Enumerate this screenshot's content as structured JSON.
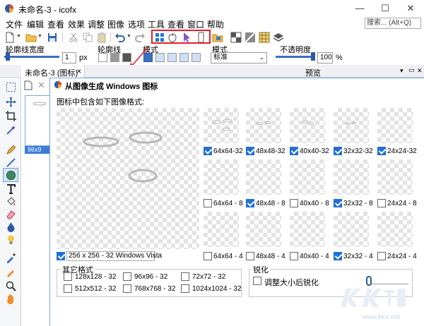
{
  "window": {
    "title": "未命名-3 - icofx",
    "minimize": "—",
    "maximize": "☐",
    "close": "✕"
  },
  "menu": [
    "文件",
    "编辑",
    "查看",
    "效果",
    "调整",
    "图像",
    "选项",
    "工具",
    "查看",
    "窗口",
    "帮助"
  ],
  "search": {
    "placeholder": "搜索... (Alt+Q)"
  },
  "props": {
    "outline_width_label": "轮廓线宽度",
    "outline_width_value": "1",
    "outline_width_unit": "px",
    "outline_label": "轮廓线",
    "mode_label": "模式",
    "mode2_label": "模式",
    "mode2_value": "标准",
    "opacity_label": "不透明度",
    "opacity_value": "100",
    "opacity_unit": "%"
  },
  "tabs": {
    "doc_tab": "未命名-3 (图标)",
    "preview": "预览",
    "close_glyph": "✕"
  },
  "thumb_label": "96x9",
  "dialog": {
    "title": "从图像生成 Windows 图标",
    "instruction": "图标中包含如下图像格式:",
    "big_format": "256 x 256 - 32    Windows Vista",
    "rows": [
      {
        "items": [
          {
            "label": "64x64-32",
            "checked": true
          },
          {
            "label": "48x48-32",
            "checked": true
          },
          {
            "label": "40x40-32",
            "checked": true
          },
          {
            "label": "32x32-32",
            "checked": true
          },
          {
            "label": "24x24-32",
            "checked": true
          }
        ]
      },
      {
        "items": [
          {
            "label": "64x64 - 8",
            "checked": false
          },
          {
            "label": "48x48 - 8",
            "checked": true
          },
          {
            "label": "40x40 - 8",
            "checked": false
          },
          {
            "label": "32x32 - 8",
            "checked": true
          },
          {
            "label": "24x24 - 8",
            "checked": false
          }
        ]
      },
      {
        "items": [
          {
            "label": "64x64 - 4",
            "checked": false
          },
          {
            "label": "48x48 - 4",
            "checked": false
          },
          {
            "label": "40x40 - 4",
            "checked": false
          },
          {
            "label": "32x32 - 4",
            "checked": true
          },
          {
            "label": "24x24 - 4",
            "checked": false
          }
        ]
      }
    ],
    "other_formats_label": "其它格式",
    "other_formats": [
      [
        "128x128 - 32",
        "96x96 - 32",
        "72x72 - 32"
      ],
      [
        "512x512 - 32",
        "768x768 - 32",
        "1024x1024 - 32"
      ]
    ],
    "sharpen_label": "锐化",
    "sharpen_check": "调整大小后锐化"
  },
  "watermark": {
    "brand": "KK下载",
    "url": "www.kkx.net"
  }
}
